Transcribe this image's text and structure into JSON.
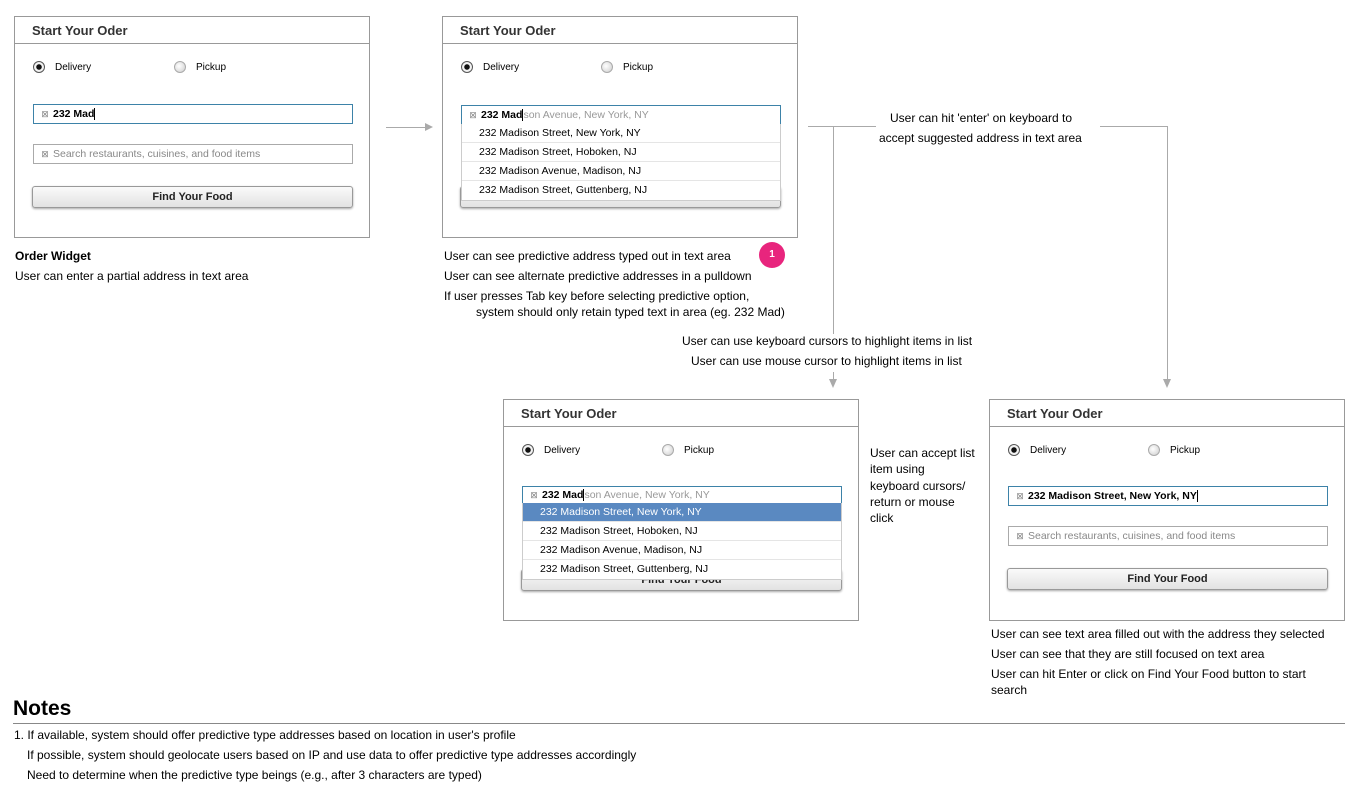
{
  "widget": {
    "title": "Start Your Oder",
    "delivery_label": "Delivery",
    "pickup_label": "Pickup",
    "search_placeholder": "Search restaurants, cuisines, and food items",
    "find_button": "Find Your Food",
    "clear_icon": "⊠"
  },
  "address": {
    "typed": "232 Mad",
    "ghost": "son Avenue, New York, NY",
    "selected": "232 Madison Street, New York, NY"
  },
  "suggestions": [
    "232 Madison Street, New York, NY",
    "232 Madison Street, Hoboken, NJ",
    "232 Madison Avenue, Madison, NJ",
    "232 Madison Street, Guttenberg, NJ"
  ],
  "annotations": {
    "w1_title": "Order Widget",
    "w1_line1": "User can enter a partial address in text area",
    "w2_line1": "User can see predictive address typed out in text area",
    "w2_badge": "1",
    "w2_line2": "User can see alternate predictive addresses in a pulldown",
    "w2_line3a": "If user presses Tab key before selecting predictive option,",
    "w2_line3b": "system should only retain typed text in area (eg. 232 Mad)",
    "enter_line1": "User can hit 'enter' on keyboard to",
    "enter_line2": "accept suggested address in text area",
    "cursor_line1": "User can use keyboard cursors to highlight items in list",
    "cursor_line2": "User can use mouse cursor to highlight items in list",
    "accept_line1": "User can accept list",
    "accept_line2": "item using",
    "accept_line3": "keyboard cursors/",
    "accept_line4": "return or mouse",
    "accept_line5": "click",
    "w4_line1": "User can see text area filled out with the address they selected",
    "w4_line2": "User can see that they are still focused on text area",
    "w4_line3": "User can hit Enter or click on Find Your Food button to start",
    "w4_line4": "search"
  },
  "notes": {
    "heading": "Notes",
    "line1": "1. If available, system should offer predictive type addresses based on location in user's profile",
    "line2": "If possible, system should geolocate users based on IP and use data to offer predictive type addresses accordingly",
    "line3": "Need to determine when the predictive type beings (e.g., after 3 characters are typed)"
  },
  "colors": {
    "highlight": "#5a89c1",
    "badge": "#e8257d",
    "focus_border": "#3d82a8"
  }
}
